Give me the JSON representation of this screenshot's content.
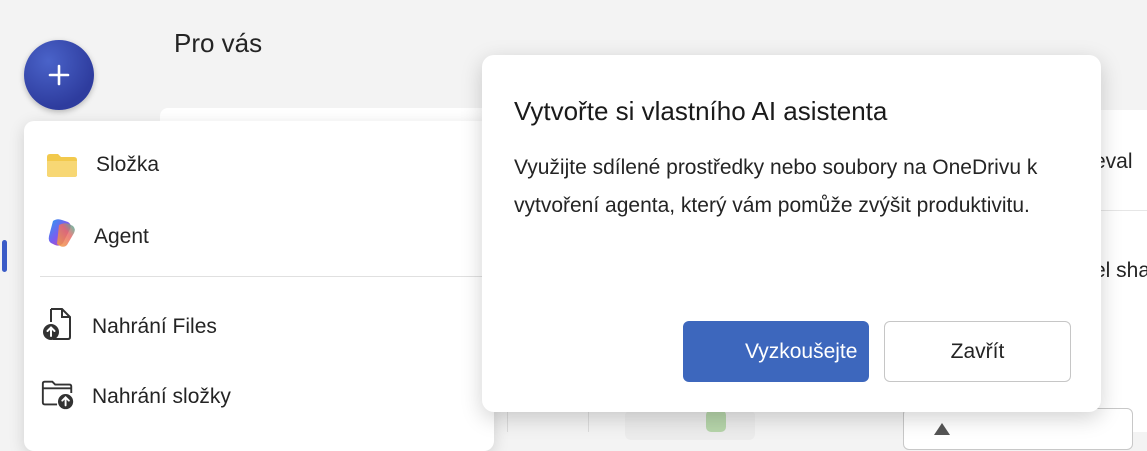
{
  "header": {
    "page_title": "Pro vás"
  },
  "new_menu": {
    "items": [
      {
        "label": "Složka",
        "icon": "folder-icon"
      },
      {
        "label": "Agent",
        "icon": "copilot-icon"
      },
      {
        "label": "Nahrání Files",
        "icon": "file-upload-icon"
      },
      {
        "label": "Nahrání složky",
        "icon": "folder-upload-icon"
      }
    ]
  },
  "popover": {
    "title": "Vytvořte si vlastního AI asistenta",
    "body": "Využijte sdílené prostředky nebo soubory na OneDrivu k vytvoření agenta, který vám pomůže zvýšit produktivitu.",
    "primary_label": "Vyzkoušejte",
    "secondary_label": "Zavřít"
  },
  "background": {
    "right_text_1": "eval",
    "right_text_2": "el sha"
  },
  "colors": {
    "accent": "#3d67bd",
    "new_button": "#3a4db5"
  }
}
